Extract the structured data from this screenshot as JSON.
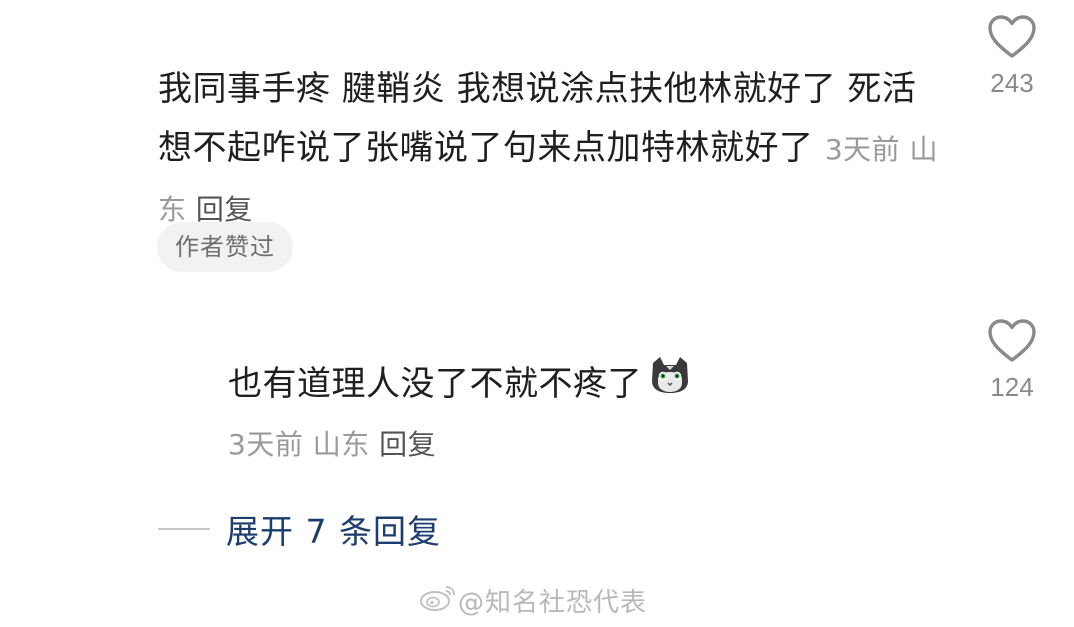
{
  "comment": {
    "text": "我同事手疼  腱鞘炎  我想说涂点扶他林就好了  死活想不起咋说了张嘴说了句来点加特林就好了",
    "time": "3天前",
    "location": "山东",
    "reply_label": "回复",
    "author_liked_badge": "作者赞过",
    "like_count": "243"
  },
  "reply": {
    "text": "也有道理人没了不就不疼了",
    "emoji_icon": "cat-face-emoji-icon",
    "time": "3天前",
    "location": "山东",
    "reply_label": "回复",
    "like_count": "124"
  },
  "expand": {
    "label": "展开 7 条回复"
  },
  "watermark": {
    "text": "@知名社恐代表",
    "icon": "weibo-icon"
  },
  "colors": {
    "text": "#1f1f1f",
    "meta": "#9a9a9a",
    "link": "#1c3d6e",
    "badge_bg": "#f2f2f2"
  }
}
